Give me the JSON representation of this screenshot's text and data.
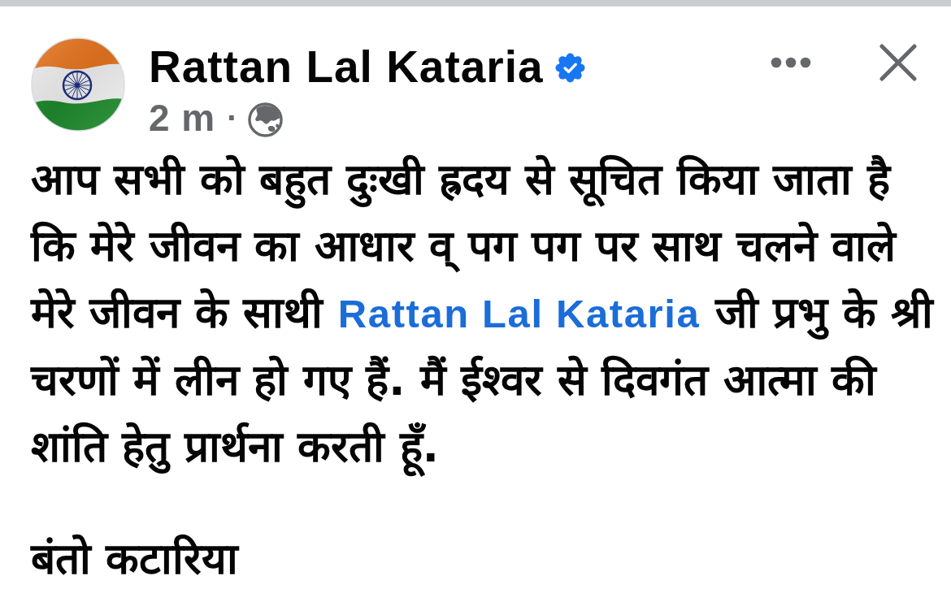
{
  "post": {
    "author": {
      "name": "Rattan Lal Kataria",
      "verified": true
    },
    "timestamp": "2 m",
    "separator": "·",
    "body": [
      {
        "segments": [
          {
            "kind": "text",
            "text": "आप सभी को बहुत दुःखी ह्रदय से सूचित किया जाता है कि मेरे जीवन का आधार व् पग पग पर साथ चलने वाले मेरे जीवन के साथी "
          },
          {
            "kind": "link",
            "text": "Rattan Lal Kataria"
          },
          {
            "kind": "text",
            "text": " जी प्रभु के श्री चरणों में लीन हो गए हैं. मैं ईश्वर से दिवगंत आत्मा की शांति हेतु प्रार्थना करती हूँ."
          }
        ]
      },
      {
        "segments": [
          {
            "kind": "text",
            "text": "बंतो कटारिया"
          }
        ]
      }
    ]
  }
}
